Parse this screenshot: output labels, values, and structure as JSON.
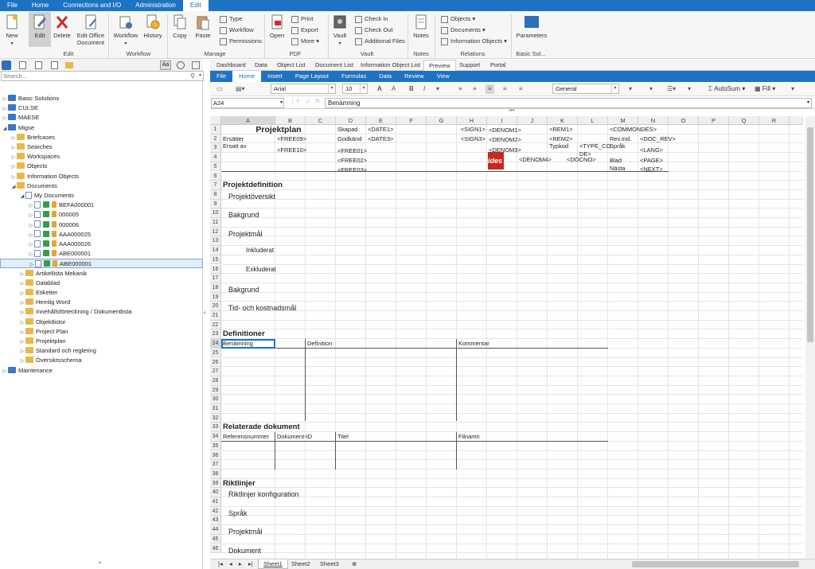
{
  "top_tabs": [
    "File",
    "Home",
    "Connections and I/O",
    "Administration",
    "Edit"
  ],
  "ribbon": {
    "buttons": {
      "new": "New",
      "edit": "Edit",
      "delete": "Delete",
      "edit_office": "Edit Office Document",
      "workflow": "Workflow",
      "history": "History",
      "copy": "Copy",
      "paste": "Paste",
      "open": "Open",
      "vault": "Vault",
      "notes": "Notes",
      "parameters": "Parameters"
    },
    "small": {
      "type": "Type",
      "workflow": "Workflow",
      "permissions": "Permissions",
      "print": "Print",
      "export": "Export",
      "more": "More",
      "check_in": "Check In",
      "check_out": "Check Out",
      "additional_files": "Additional Files",
      "objects": "Objects",
      "documents": "Documents",
      "information_objects": "Information Objects"
    },
    "groups": {
      "edit": "Edit",
      "workflow": "Workflow",
      "manage": "Manage",
      "pdf": "PDF",
      "vault": "Vault",
      "notes": "Notes",
      "relations": "Relations",
      "basic": "Basic Sol..."
    }
  },
  "left": {
    "search_placeholder": "Search...",
    "tree": [
      {
        "label": "Basic Solutions",
        "level": 0,
        "icon": "db"
      },
      {
        "label": "CULSE",
        "level": 0,
        "icon": "db"
      },
      {
        "label": "MAESE",
        "level": 0,
        "icon": "db"
      },
      {
        "label": "Migse",
        "level": 0,
        "icon": "db",
        "open": true
      },
      {
        "label": "Briefcases",
        "level": 1,
        "icon": "folder"
      },
      {
        "label": "Searches",
        "level": 1,
        "icon": "folder"
      },
      {
        "label": "Workspaces",
        "level": 1,
        "icon": "folder"
      },
      {
        "label": "Objects",
        "level": 1,
        "icon": "folder"
      },
      {
        "label": "Information Objects",
        "level": 1,
        "icon": "folder"
      },
      {
        "label": "Documents",
        "level": 1,
        "icon": "folder",
        "open": true
      },
      {
        "label": "My Documents",
        "level": 2,
        "icon": "doc",
        "open": true
      },
      {
        "label": "BEFA000001",
        "level": 3,
        "icon": "doc"
      },
      {
        "label": "000005",
        "level": 3,
        "icon": "doc"
      },
      {
        "label": "000006",
        "level": 3,
        "icon": "doc"
      },
      {
        "label": "AAA000025",
        "level": 3,
        "icon": "doc"
      },
      {
        "label": "AAA000026",
        "level": 3,
        "icon": "doc"
      },
      {
        "label": "ABE000001",
        "level": 3,
        "icon": "doc"
      },
      {
        "label": "ABE000001",
        "level": 3,
        "icon": "doc",
        "selected": true
      },
      {
        "label": "Artikellista Mekanik",
        "level": 2,
        "icon": "folder"
      },
      {
        "label": "Datablad",
        "level": 2,
        "icon": "folder"
      },
      {
        "label": "Etiketter",
        "level": 2,
        "icon": "folder"
      },
      {
        "label": "Hemlig Word",
        "level": 2,
        "icon": "folder"
      },
      {
        "label": "Innehållsförteckning / Dokumentlista",
        "level": 2,
        "icon": "folder"
      },
      {
        "label": "Objektlistor",
        "level": 2,
        "icon": "folder"
      },
      {
        "label": "Project Plan",
        "level": 2,
        "icon": "folder"
      },
      {
        "label": "Projektplan",
        "level": 2,
        "icon": "folder"
      },
      {
        "label": "Standard och reglering",
        "level": 2,
        "icon": "folder"
      },
      {
        "label": "Översiktsschema",
        "level": 2,
        "icon": "folder"
      },
      {
        "label": "Maintenance",
        "level": 0,
        "icon": "db"
      }
    ]
  },
  "doc_tabs": [
    "Dashboard",
    "Data",
    "Object List",
    "Document List",
    "Information Object List",
    "Preview",
    "Support",
    "Portal"
  ],
  "sheet_tabs": [
    "File",
    "Home",
    "Insert",
    "Page Layout",
    "Formulas",
    "Data",
    "Review",
    "View"
  ],
  "toolbar": {
    "font": "Arial",
    "size": "10",
    "format": "General",
    "autosum": "AutoSum",
    "fill": "Fill"
  },
  "formula": {
    "cellref": "A24",
    "value": "Benämning"
  },
  "columns": [
    "A",
    "B",
    "C",
    "D",
    "E",
    "F",
    "G",
    "H",
    "I",
    "J",
    "K",
    "L",
    "M",
    "N",
    "O",
    "P",
    "Q",
    "R",
    "S"
  ],
  "cells": {
    "title": "Projektplan",
    "skapad": "Skapad",
    "date1": "<DATE1>",
    "sign1": "<SIGN1>",
    "denom1": "<DENOM1>",
    "rem1": "<REM1>",
    "commondes": "<COMMONDES>",
    "ersatter": "Ersätter",
    "free09": "<FREE09>",
    "godkand": "Godkänd",
    "date3": "<DATE3>",
    "sign3": "<SIGN3>",
    "denom2": "<DENOM2>",
    "rem2": "<REM2>",
    "revind": "Rev.Ind.",
    "docrev": "<DOC_REV>",
    "ersattav": "Ersatt av",
    "free10": "<FREE10>",
    "free01": "<FREE01>",
    "denom3": "<DENOM3>",
    "typkod": "Typkod",
    "typecode": "<TYPE_CO DE>",
    "sprak": "Språk",
    "lang": "<LANG>",
    "free02": "<FREE02>",
    "denom4": "<DENOM4>",
    "docno": "<DOCNO>",
    "blad": "Blad",
    "page": "<PAGE>",
    "free03": "<FREE03>",
    "nasta": "Nästa",
    "next": "<NEXT>",
    "logo": "ides",
    "r7": "Projektdefinition",
    "r8": "Projektöversikt",
    "r10": "Bakgrund",
    "r12": "Projektmål",
    "r14": "Inkluderat",
    "r16": "Exkluderat",
    "r18": "Bakgrund",
    "r20": "Tid- och kostnadsmål",
    "r23": "Definitioner",
    "benamning": "Benämning",
    "definition": "Definition",
    "kommentar": "Kommentar",
    "r33": "Relaterade dokument",
    "refnr": "Referensnummer",
    "dokid": "Dokument-ID",
    "titel": "Titel",
    "filnamn": "Filnamn",
    "r39": "Riktlinjer",
    "r40": "Riktlinjer konfiguration",
    "r42": "Språk",
    "r44": "Projektmål",
    "r46": "Dokument"
  },
  "sheets": [
    "Sheet1",
    "Sheet2",
    "Sheet3"
  ]
}
